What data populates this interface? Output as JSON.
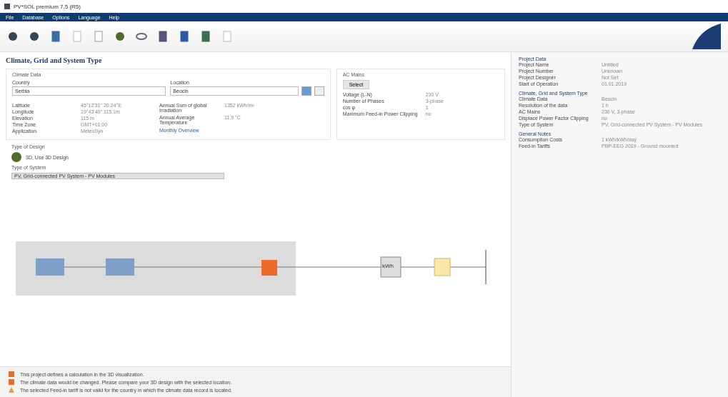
{
  "window": {
    "title": "PV*SOL premium 7.5 (R5)"
  },
  "menu": [
    "File",
    "Database",
    "Options",
    "Language",
    "Help"
  ],
  "page_title": "Climate, Grid and System Type",
  "climate": {
    "legend": "Climate Data",
    "country_label": "Country",
    "country": "Serbia",
    "location_label": "Location",
    "location": "Beocin",
    "left_rows": [
      {
        "label": "Latitude",
        "value": "45°12'31\" 20.24°E"
      },
      {
        "label": "Longitude",
        "value": "19°43'40\" 115.1m"
      },
      {
        "label": "Elevation",
        "value": "115 m"
      },
      {
        "label": "Time Zone",
        "value": "GMT+01:00"
      },
      {
        "label": "Application",
        "value": "MeteoSyn"
      }
    ],
    "right_rows": [
      {
        "label": "Annual Sum of global Irradiation",
        "value": "1352 kWh/m²"
      },
      {
        "label": "Annual Average Temperature",
        "value": "11.9 °C"
      }
    ],
    "link": "Monthly Overview"
  },
  "ac_mains": {
    "legend": "AC Mains",
    "button": "Select",
    "rows": [
      {
        "label": "Voltage (L-N)",
        "value": "230 V"
      },
      {
        "label": "Number of Phases",
        "value": "3-phase"
      },
      {
        "label": "cos φ",
        "value": "1"
      },
      {
        "label": "Maximum Feed-in Power Clipping",
        "value": "no"
      }
    ]
  },
  "design": {
    "legend": "Type of Design",
    "option": "3D, Use 3D Design"
  },
  "system": {
    "legend": "Type of System",
    "value": "PV, Grid-connected PV System - PV Modules"
  },
  "diagram": {
    "meter": "kWh"
  },
  "messages": [
    {
      "kind": "error",
      "text": "This project defines a calculation in the 3D visualization."
    },
    {
      "kind": "error",
      "text": "The climate data would be changed. Please compare your 3D design with the selected location."
    },
    {
      "kind": "warning",
      "text": "The selected Feed-in tariff is not valid for the country in which the climate data record is located."
    }
  ],
  "summary": [
    {
      "heading": "Project Data",
      "rows": [
        {
          "label": "Project Name",
          "value": "Untitled"
        },
        {
          "label": "Project Number",
          "value": "Unknown"
        },
        {
          "label": "Project Designer",
          "value": "Not Set"
        },
        {
          "label": "Start of Operation",
          "value": "01.01.2019"
        }
      ]
    },
    {
      "heading": "Climate, Grid and System Type",
      "rows": [
        {
          "label": "Climate Data",
          "value": "Beocin"
        },
        {
          "label": "Resolution of the data",
          "value": "1 h"
        },
        {
          "label": "AC Mains",
          "value": "230 V, 3-phase"
        },
        {
          "label": "Displace Power Factor Clipping",
          "value": "no"
        },
        {
          "label": "Type of System",
          "value": "PV, Grid-connected PV System - PV Modules"
        }
      ]
    },
    {
      "heading": "General Notes",
      "rows": [
        {
          "label": "Consumption Costs",
          "value": "1 kWh/kWh/day"
        },
        {
          "label": "Feed-in Tariffs",
          "value": "PBP-EEG 2019 - Ground mounted"
        }
      ]
    }
  ]
}
